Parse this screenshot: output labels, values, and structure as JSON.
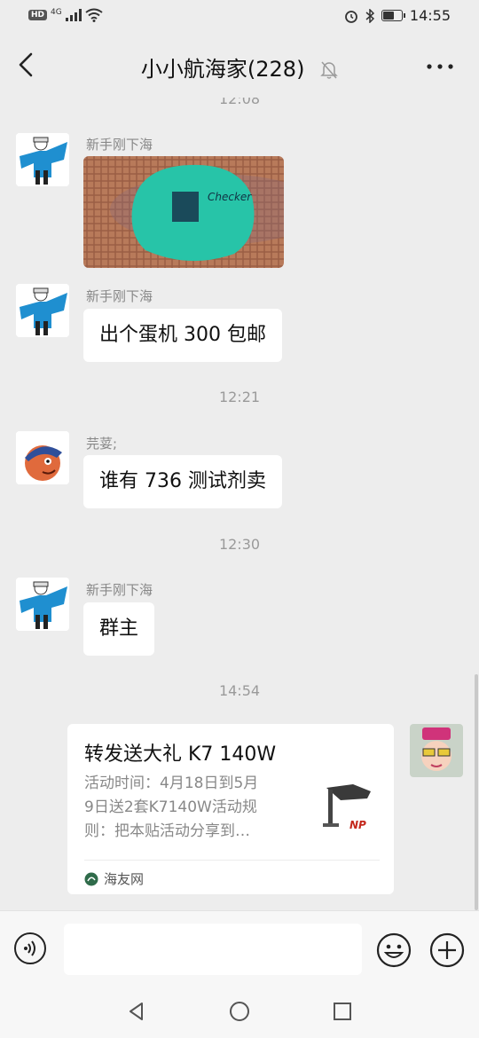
{
  "status_bar": {
    "left_badge": "HD",
    "network": "4G",
    "time": "14:55",
    "battery_level": 0.55
  },
  "header": {
    "title": "小小航海家(228)"
  },
  "messages": [
    {
      "type": "timestamp",
      "text": "12:08"
    },
    {
      "type": "image",
      "sender": "新手刚下海"
    },
    {
      "type": "text",
      "sender": "新手刚下海",
      "text": "出个蛋机 300 包邮"
    },
    {
      "type": "timestamp",
      "text": "12:21"
    },
    {
      "type": "text",
      "sender": "芫荽;",
      "text": "谁有 736 测试剂卖"
    },
    {
      "type": "timestamp",
      "text": "12:30"
    },
    {
      "type": "text",
      "sender": "新手刚下海",
      "text": "群主"
    },
    {
      "type": "timestamp",
      "text": "14:54"
    },
    {
      "type": "link_card",
      "title": "转发送大礼 K7 140W",
      "desc_lines": [
        "活动时间：4月18日到5月",
        "9日送2套K7140W活动规",
        "则：把本贴活动分享到…"
      ],
      "source": "海友网",
      "thumb_brand": "NP"
    }
  ],
  "icons": {
    "back": "chevron-left-icon",
    "mute": "bell-off-icon",
    "more": "more-dots-icon",
    "voice": "voice-icon",
    "emoji": "emoji-icon",
    "plus": "plus-icon"
  }
}
